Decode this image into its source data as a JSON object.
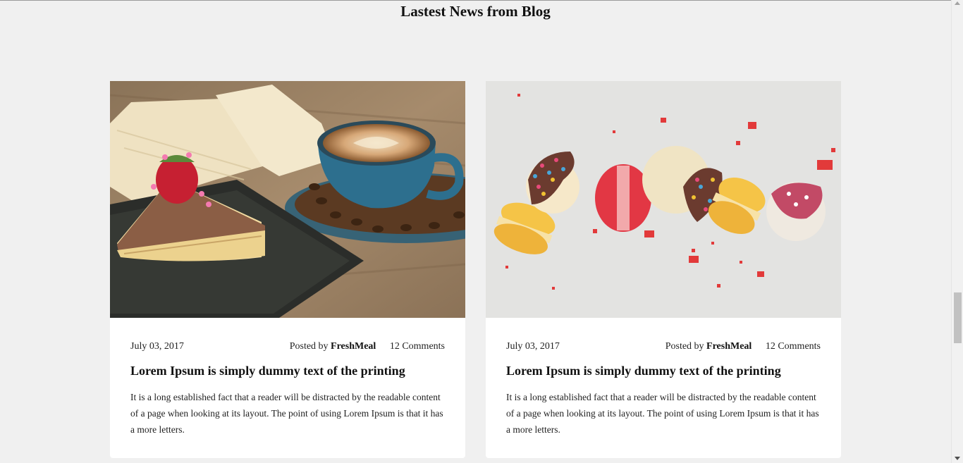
{
  "section": {
    "title": "Lastest News from Blog"
  },
  "posts": [
    {
      "image": "cake-and-coffee-photo",
      "date": "July 03, 2017",
      "posted_by_label": "Posted by",
      "author": "FreshMeal",
      "comments": "12 Comments",
      "title": "Lorem Ipsum is simply dummy text of the printing",
      "excerpt": "It is a long established fact that a reader will be distracted by the readable content of a page when looking at its layout. The point of using Lorem Ipsum is that it has a more letters."
    },
    {
      "image": "macarons-photo",
      "date": "July 03, 2017",
      "posted_by_label": "Posted by",
      "author": "FreshMeal",
      "comments": "12 Comments",
      "title": "Lorem Ipsum is simply dummy text of the printing",
      "excerpt": "It is a long established fact that a reader will be distracted by the readable content of a page when looking at its layout. The point of using Lorem Ipsum is that it has a more letters."
    }
  ],
  "colors": {
    "page_bg": "#f0f0f0",
    "card_bg": "#ffffff",
    "text": "#111111"
  }
}
